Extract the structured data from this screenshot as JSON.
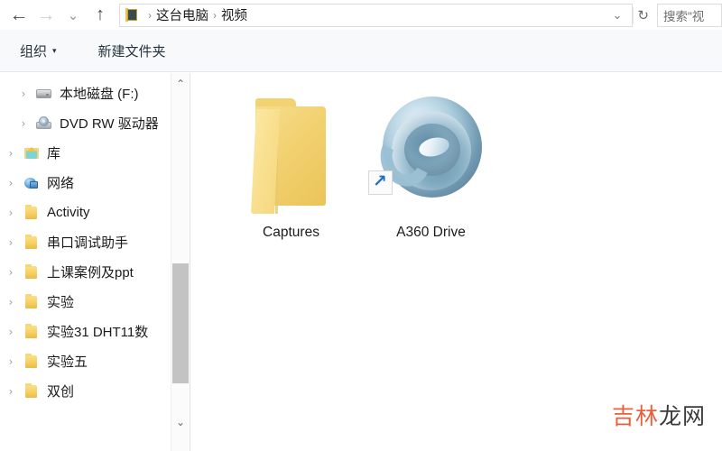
{
  "window": {
    "app": "File Explorer"
  },
  "nav": {
    "back_icon": "arrow-left-icon",
    "back_label": "←",
    "forward_label": "→",
    "history_label": "⌄",
    "up_label": "↑",
    "address": {
      "pc_icon": "this-pc-icon",
      "separator": "›",
      "crumbs": [
        "这台电脑",
        "视频"
      ],
      "dropdown_label": "⌄",
      "refresh_label": "↻"
    },
    "search": {
      "placeholder": "搜索\"视"
    }
  },
  "toolbar": {
    "organize_label": "组织",
    "organize_caret": "▾",
    "new_folder_label": "新建文件夹"
  },
  "sidebar": {
    "scroll": {
      "up_label": "⌃",
      "down_label": "⌄"
    },
    "items": [
      {
        "label": "本地磁盘 (F:)",
        "icon": "drive-icon",
        "chevron": "›",
        "indent": 1
      },
      {
        "label": "DVD RW 驱动器",
        "icon": "dvd-drive-icon",
        "chevron": "›",
        "indent": 1
      },
      {
        "label": "库",
        "icon": "library-icon",
        "chevron": "›",
        "indent": 0
      },
      {
        "label": "网络",
        "icon": "network-icon",
        "chevron": "›",
        "indent": 0
      },
      {
        "label": "Activity",
        "icon": "folder-icon",
        "chevron": "›",
        "indent": 0
      },
      {
        "label": "串口调试助手",
        "icon": "folder-icon",
        "chevron": "›",
        "indent": 0
      },
      {
        "label": "上课案例及ppt",
        "icon": "folder-icon",
        "chevron": "›",
        "indent": 0
      },
      {
        "label": "实验",
        "icon": "folder-icon",
        "chevron": "›",
        "indent": 0
      },
      {
        "label": "实验31 DHT11数",
        "icon": "folder-icon",
        "chevron": "›",
        "indent": 0
      },
      {
        "label": "实验五",
        "icon": "folder-icon",
        "chevron": "›",
        "indent": 0
      },
      {
        "label": "双创",
        "icon": "folder-icon",
        "chevron": "›",
        "indent": 0
      }
    ]
  },
  "content": {
    "items": [
      {
        "name": "Captures",
        "icon": "folder-icon"
      },
      {
        "name": "A360 Drive",
        "icon": "a360-drive-icon",
        "shortcut": true,
        "shortcut_arrow": "↗"
      }
    ]
  },
  "watermark": {
    "part1": "吉林",
    "part2": "龙网",
    "color1": "#e8603c",
    "color2": "#3b3b3b"
  }
}
